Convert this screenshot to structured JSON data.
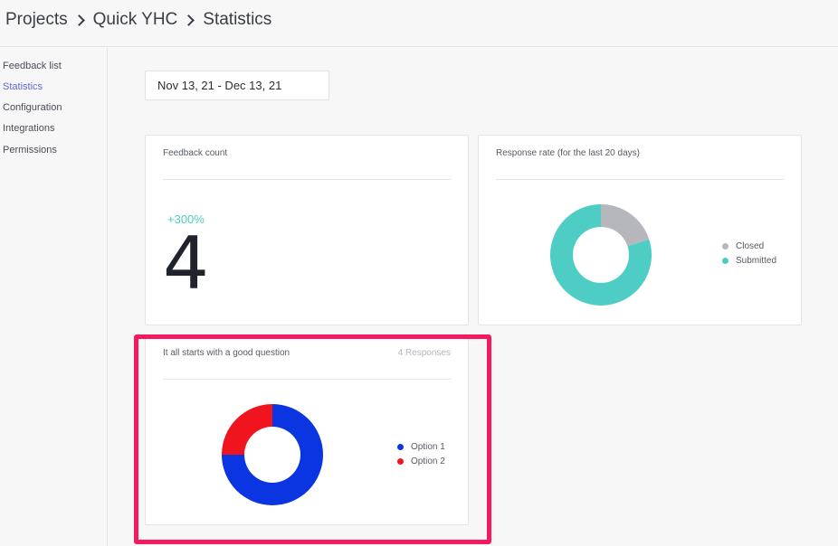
{
  "header": {
    "breadcrumb": [
      "Projects",
      "Quick YHC",
      "Statistics"
    ]
  },
  "sidebar": {
    "items": [
      {
        "label": "Feedback list",
        "active": false
      },
      {
        "label": "Statistics",
        "active": true
      },
      {
        "label": "Configuration",
        "active": false
      },
      {
        "label": "Integrations",
        "active": false
      },
      {
        "label": "Permissions",
        "active": false
      }
    ]
  },
  "date_range": "Nov 13, 21 - Dec 13, 21",
  "feedback_card": {
    "title": "Feedback count",
    "change": "+300%",
    "count": "4"
  },
  "response_card": {
    "title": "Response rate (for the last 20 days)",
    "legend": [
      {
        "label": "Closed",
        "color": "#b5b7bd"
      },
      {
        "label": "Submitted",
        "color": "#4ecdc4"
      }
    ]
  },
  "question_card": {
    "title": "It all starts with a good question",
    "responses": "4 Responses",
    "legend": [
      {
        "label": "Option 1",
        "color": "#0a35e0"
      },
      {
        "label": "Option 2",
        "color": "#f0141e"
      }
    ]
  },
  "chart_data": [
    {
      "type": "pie",
      "title": "Response rate (for the last 20 days)",
      "categories": [
        "Closed",
        "Submitted"
      ],
      "values": [
        20,
        80
      ],
      "colors": [
        "#b5b7bd",
        "#4ecdc4"
      ],
      "legend": "right"
    },
    {
      "type": "pie",
      "title": "It all starts with a good question",
      "categories": [
        "Option 1",
        "Option 2"
      ],
      "values": [
        75,
        25
      ],
      "colors": [
        "#0a35e0",
        "#f0141e"
      ],
      "legend": "right"
    }
  ]
}
